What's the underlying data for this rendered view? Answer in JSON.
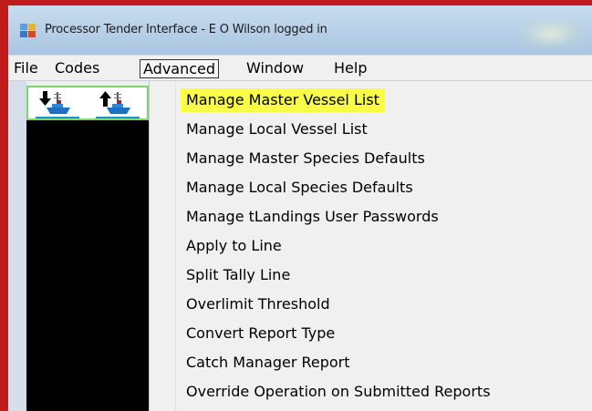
{
  "window": {
    "title": "Processor Tender Interface - E O Wilson logged in"
  },
  "menubar": {
    "items": [
      {
        "label": "File"
      },
      {
        "label": "Codes"
      },
      {
        "label": "Advanced",
        "active": true
      },
      {
        "label": "Window"
      },
      {
        "label": "Help"
      }
    ]
  },
  "toolbar": {
    "buttons": [
      {
        "icon": "download-vessel-icon"
      },
      {
        "icon": "upload-vessel-icon"
      }
    ]
  },
  "advanced_menu": {
    "items": [
      {
        "label": "Manage Master Vessel List",
        "highlighted": true
      },
      {
        "label": "Manage Local Vessel List"
      },
      {
        "label": "Manage Master Species Defaults"
      },
      {
        "label": "Manage Local Species Defaults"
      },
      {
        "label": "Manage tLandings User Passwords"
      },
      {
        "label": "Apply to Line"
      },
      {
        "label": "Split Tally Line"
      },
      {
        "label": "Overlimit Threshold"
      },
      {
        "label": "Convert Report Type"
      },
      {
        "label": "Catch Manager Report"
      },
      {
        "label": "Override Operation on Submitted Reports"
      }
    ],
    "highlight_color": "#fafd45"
  },
  "colors": {
    "frame": "#c21b1b",
    "toolbar_border": "#79d86c",
    "workspace": "#000000"
  }
}
